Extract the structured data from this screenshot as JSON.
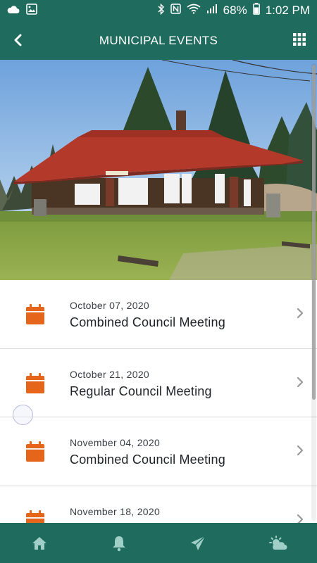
{
  "status_bar": {
    "battery_text": "68%",
    "time_text": "1:02 PM",
    "icons": [
      "cloud-icon",
      "image-icon",
      "bluetooth-icon",
      "nfc-icon",
      "wifi-icon",
      "signal-icon",
      "battery-icon"
    ]
  },
  "app_bar": {
    "title": "MUNICIPAL EVENTS",
    "back_icon": "chevron-left-icon",
    "menu_icon": "grid-icon"
  },
  "hero": {
    "subject": "historic train station photo"
  },
  "events": [
    {
      "date": "October 07, 2020",
      "title": "Combined Council Meeting"
    },
    {
      "date": "October 21, 2020",
      "title": "Regular Council Meeting"
    },
    {
      "date": "November 04, 2020",
      "title": "Combined Council Meeting"
    },
    {
      "date": "November 18, 2020",
      "title": ""
    }
  ],
  "bottom_nav": {
    "items": [
      "home-icon",
      "bell-icon",
      "send-icon",
      "weather-icon"
    ]
  },
  "colors": {
    "brand": "#1f6b5e",
    "accent": "#e5661a",
    "divider": "#d9d9d9"
  }
}
